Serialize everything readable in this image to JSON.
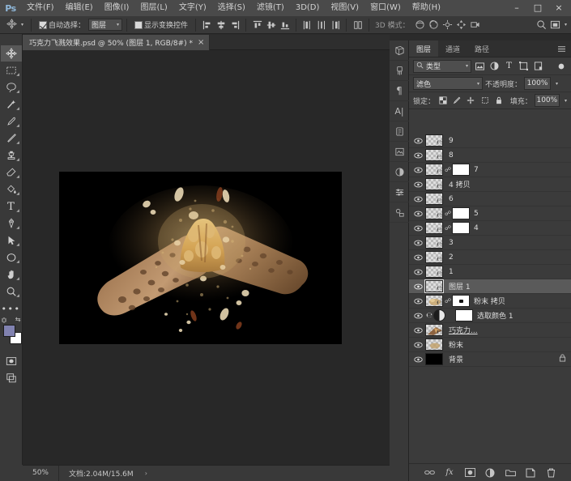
{
  "app": {
    "logo": "Ps",
    "window_buttons": [
      {
        "name": "minimize",
        "glyph": "–"
      },
      {
        "name": "maximize",
        "glyph": "□"
      },
      {
        "name": "close",
        "glyph": "×"
      }
    ]
  },
  "menu": {
    "items": [
      {
        "label": "文件(F)"
      },
      {
        "label": "编辑(E)"
      },
      {
        "label": "图像(I)"
      },
      {
        "label": "图层(L)"
      },
      {
        "label": "文字(Y)"
      },
      {
        "label": "选择(S)"
      },
      {
        "label": "滤镜(T)"
      },
      {
        "label": "3D(D)"
      },
      {
        "label": "视图(V)"
      },
      {
        "label": "窗口(W)"
      },
      {
        "label": "帮助(H)"
      }
    ]
  },
  "options_bar": {
    "tool_icon": "move-tool-icon",
    "auto_select_label": "自动选择：",
    "auto_select_checked": true,
    "auto_select_value": "图层",
    "show_transform_label": "显示变换控件",
    "show_transform_checked": false,
    "mode_3d_label": "3D 模式："
  },
  "document_tab": {
    "title": "巧克力飞溅效果.psd @ 50% (图层 1, RGB/8#) *",
    "close": "×"
  },
  "toolbar": {
    "tools": [
      {
        "name": "move-tool",
        "active": true
      },
      {
        "name": "marquee-tool",
        "active": false
      },
      {
        "name": "lasso-tool",
        "active": false
      },
      {
        "name": "magic-wand-tool",
        "active": false
      },
      {
        "name": "eyedropper-tool",
        "active": false
      },
      {
        "name": "brush-tool",
        "active": false
      },
      {
        "name": "clone-stamp-tool",
        "active": false
      },
      {
        "name": "eraser-tool",
        "active": false
      },
      {
        "name": "paint-bucket-tool",
        "active": false
      },
      {
        "name": "type-tool",
        "active": false
      },
      {
        "name": "pen-tool",
        "active": false
      },
      {
        "name": "path-selection-tool",
        "active": false
      },
      {
        "name": "ellipse-shape-tool",
        "active": false
      },
      {
        "name": "hand-tool",
        "active": false
      },
      {
        "name": "zoom-tool",
        "active": false
      },
      {
        "name": "more-tools",
        "active": false
      }
    ],
    "foreground_color": "#8182b0",
    "background_color": "#ffffff"
  },
  "dock_rail": {
    "icons": [
      {
        "name": "3d-panel-icon"
      },
      {
        "name": "brush-presets-icon"
      },
      {
        "name": "paragraph-panel-icon"
      },
      {
        "name": "character-panel-icon"
      },
      {
        "name": "history-panel-icon"
      },
      {
        "name": "layer-comps-icon"
      },
      {
        "name": "adjustments-panel-icon"
      },
      {
        "name": "properties-panel-icon"
      },
      {
        "name": "styles-panel-icon"
      }
    ]
  },
  "layers_panel": {
    "tabs": [
      {
        "label": "图层",
        "active": true
      },
      {
        "label": "通道",
        "active": false
      },
      {
        "label": "路径",
        "active": false
      }
    ],
    "filter": {
      "kind_label": "类型",
      "icons": [
        "pixel-filter-icon",
        "adjustment-filter-icon",
        "type-filter-icon",
        "shape-filter-icon",
        "smart-object-filter-icon"
      ],
      "toggle": "filter-power-icon"
    },
    "blend_mode": "滤色",
    "opacity_label": "不透明度：",
    "opacity_value": "100%",
    "lock_label": "锁定：",
    "lock_icons": [
      "lock-transparent-icon",
      "lock-image-icon",
      "lock-position-icon",
      "lock-artboard-icon",
      "lock-all-icon"
    ],
    "fill_label": "填充：",
    "fill_value": "100%",
    "layers": [
      {
        "name": "9",
        "visible": true,
        "has_mask": false,
        "selected": false,
        "type": "pixel"
      },
      {
        "name": "8",
        "visible": true,
        "has_mask": false,
        "selected": false,
        "type": "pixel"
      },
      {
        "name": "7",
        "visible": true,
        "has_mask": true,
        "selected": false,
        "type": "pixel"
      },
      {
        "name": "4 拷贝",
        "visible": true,
        "has_mask": false,
        "selected": false,
        "type": "pixel"
      },
      {
        "name": "6",
        "visible": true,
        "has_mask": false,
        "selected": false,
        "type": "pixel"
      },
      {
        "name": "5",
        "visible": true,
        "has_mask": true,
        "selected": false,
        "type": "pixel"
      },
      {
        "name": "4",
        "visible": true,
        "has_mask": true,
        "selected": false,
        "type": "pixel"
      },
      {
        "name": "3",
        "visible": true,
        "has_mask": false,
        "selected": false,
        "type": "pixel"
      },
      {
        "name": "2",
        "visible": true,
        "has_mask": false,
        "selected": false,
        "type": "pixel"
      },
      {
        "name": "1",
        "visible": true,
        "has_mask": false,
        "selected": false,
        "type": "pixel"
      },
      {
        "name": "图层 1",
        "visible": true,
        "has_mask": false,
        "selected": true,
        "type": "pixel"
      },
      {
        "name": "粉末 拷贝",
        "visible": true,
        "has_mask": true,
        "selected": false,
        "type": "powder"
      },
      {
        "name": "选取颜色 1",
        "visible": true,
        "has_mask": true,
        "selected": false,
        "type": "adjustment"
      },
      {
        "name": "巧克力...",
        "visible": true,
        "has_mask": false,
        "selected": false,
        "type": "chocolate"
      },
      {
        "name": "粉末",
        "visible": true,
        "has_mask": false,
        "selected": false,
        "type": "powder"
      },
      {
        "name": "背景",
        "visible": true,
        "has_mask": false,
        "selected": false,
        "type": "background",
        "locked": true
      }
    ],
    "footer_buttons": [
      {
        "name": "link-layers-button",
        "glyph": "∞"
      },
      {
        "name": "layer-style-fx-button",
        "glyph": "fx"
      },
      {
        "name": "add-mask-button",
        "glyph": "▣"
      },
      {
        "name": "adjustment-layer-button",
        "glyph": "◑"
      },
      {
        "name": "new-group-button",
        "glyph": "▭"
      },
      {
        "name": "new-layer-button",
        "glyph": "⧉"
      },
      {
        "name": "delete-layer-button",
        "glyph": "☒"
      }
    ]
  },
  "status_bar": {
    "zoom": "50%",
    "doc_info": "文档:2.04M/15.6M",
    "arrow": "›"
  }
}
